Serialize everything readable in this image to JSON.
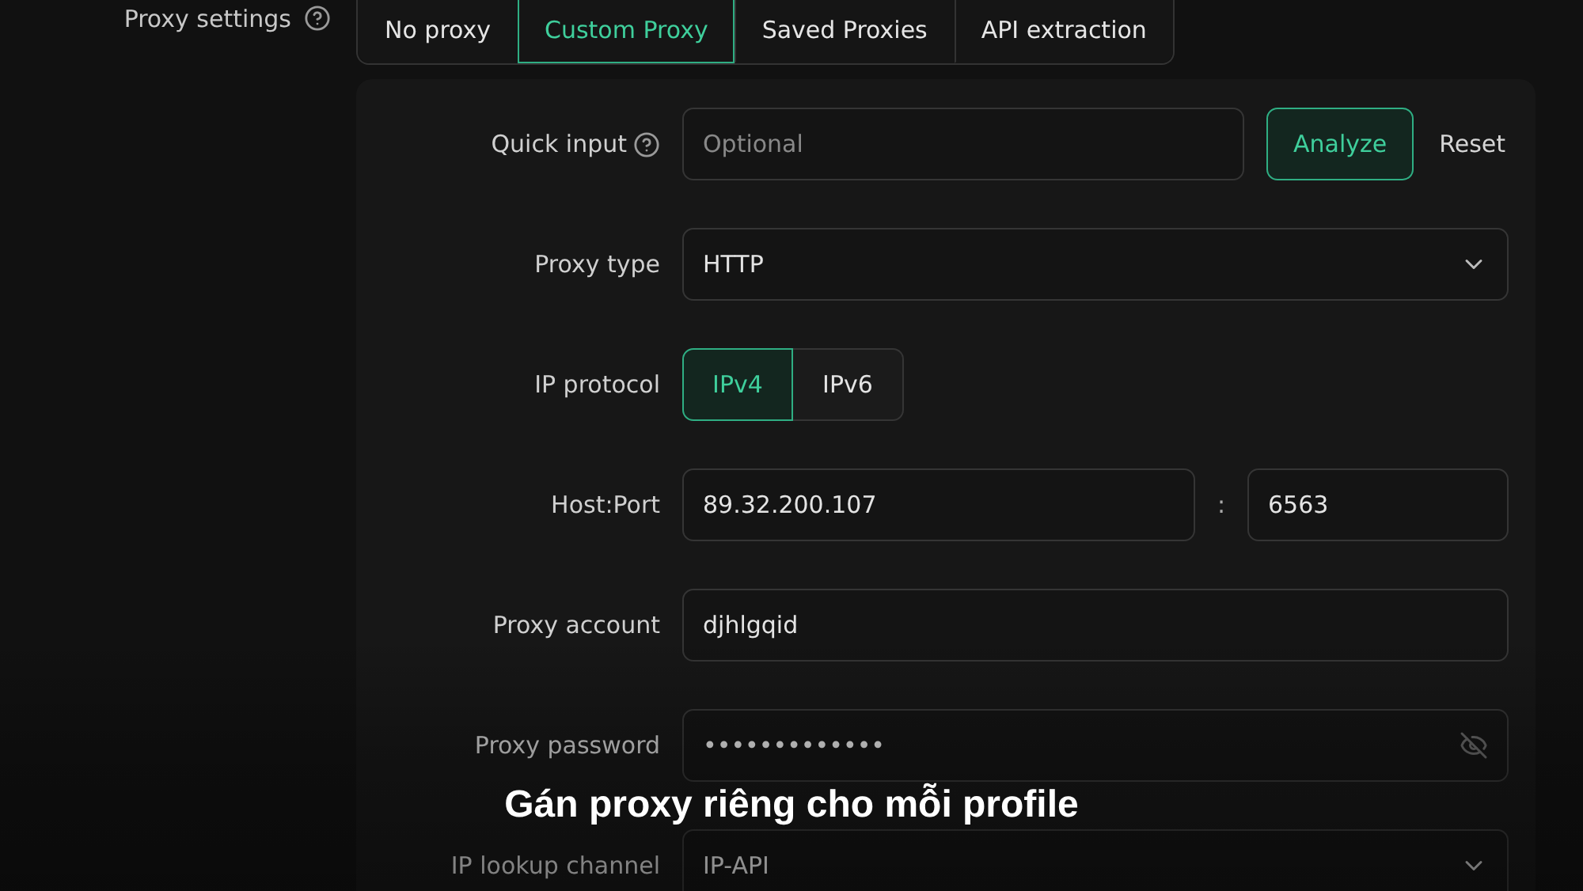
{
  "proxy_settings": {
    "label": "Proxy settings"
  },
  "tabs": [
    {
      "label": "No proxy",
      "selected": false
    },
    {
      "label": "Custom Proxy",
      "selected": true
    },
    {
      "label": "Saved Proxies",
      "selected": false
    },
    {
      "label": "API extraction",
      "selected": false
    }
  ],
  "form": [
    {
      "kind": "quick",
      "label": "Quick input",
      "placeholder": "Optional",
      "button": "Analyze",
      "link": "Reset"
    },
    {
      "kind": "select",
      "label": "Proxy type",
      "value": "HTTP"
    },
    {
      "kind": "segmented",
      "label": "IP protocol",
      "options": [
        {
          "label": "IPv4",
          "selected": true
        },
        {
          "label": "IPv6",
          "selected": false
        }
      ]
    },
    {
      "kind": "hostport",
      "label": "Host:Port",
      "value": "89.32.200.107",
      "separator": ":",
      "port": "6563"
    },
    {
      "kind": "input",
      "label": "Proxy account",
      "value": "djhlgqid"
    },
    {
      "kind": "password",
      "label": "Proxy password",
      "value": "•••••••••••••"
    },
    {
      "kind": "select",
      "label": "IP lookup channel",
      "value": "IP-API"
    }
  ],
  "caption": "Gán proxy riêng cho mỗi profile"
}
